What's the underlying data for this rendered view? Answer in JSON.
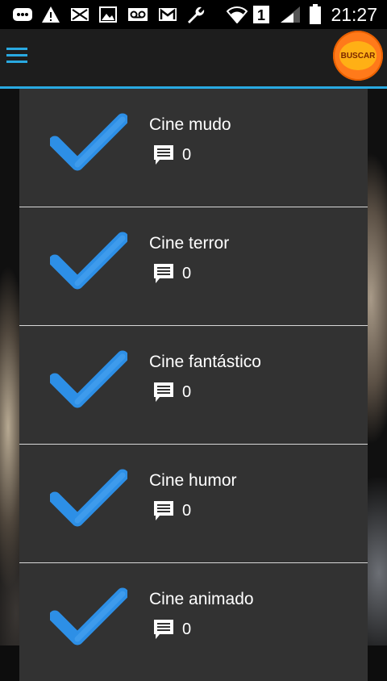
{
  "status_bar": {
    "time": "21:27",
    "sim": "1",
    "icons": [
      "bbm-icon",
      "warning-icon",
      "mail-x-icon",
      "image-icon",
      "voicemail-icon",
      "gmail-icon",
      "wrench-icon",
      "wifi-icon",
      "sim-icon",
      "signal-icon",
      "battery-icon"
    ]
  },
  "app_bar": {
    "menu_icon": "hamburger-menu-icon",
    "search_button_label": "BUSCAR",
    "accent_color": "#29a9e1",
    "search_color": "#ff7a1a"
  },
  "list": {
    "check_color": "#2d8fe6",
    "items": [
      {
        "title": "Cine mudo",
        "comments": "0"
      },
      {
        "title": "Cine terror",
        "comments": "0"
      },
      {
        "title": "Cine fantástico",
        "comments": "0"
      },
      {
        "title": "Cine humor",
        "comments": "0"
      },
      {
        "title": "Cine animado",
        "comments": "0"
      }
    ]
  }
}
